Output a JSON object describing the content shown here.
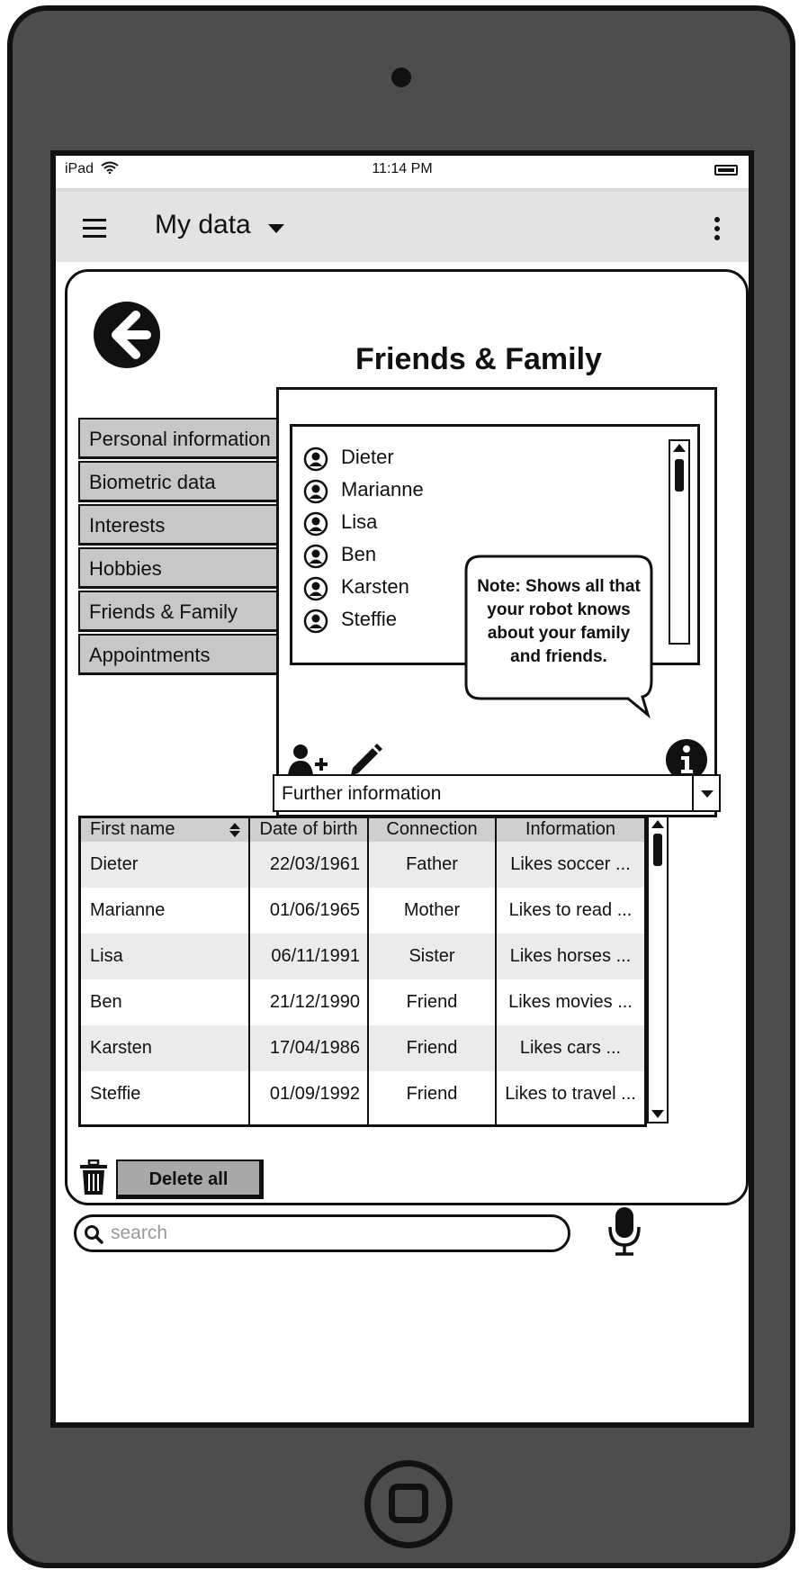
{
  "status_bar": {
    "carrier": "iPad",
    "time": "11:14 PM"
  },
  "app_bar": {
    "title": "My data"
  },
  "page": {
    "title": "Friends & Family"
  },
  "side_tabs": [
    {
      "label": "Personal information"
    },
    {
      "label": "Biometric data"
    },
    {
      "label": "Interests"
    },
    {
      "label": "Hobbies"
    },
    {
      "label": "Friends & Family"
    },
    {
      "label": "Appointments"
    }
  ],
  "people_list": [
    "Dieter",
    "Marianne",
    "Lisa",
    "Ben",
    "Karsten",
    "Steffie"
  ],
  "note": {
    "text": "Note: Shows all that your robot knows about your family and friends."
  },
  "further_info": {
    "selected": "Further information"
  },
  "table": {
    "headers": [
      "First name",
      "Date of birth",
      "Connection",
      "Information"
    ],
    "rows": [
      [
        "Dieter",
        "22/03/1961",
        "Father",
        "Likes soccer ..."
      ],
      [
        "Marianne",
        "01/06/1965",
        "Mother",
        "Likes to read ..."
      ],
      [
        "Lisa",
        "06/11/1991",
        "Sister",
        "Likes horses ..."
      ],
      [
        "Ben",
        "21/12/1990",
        "Friend",
        "Likes movies ..."
      ],
      [
        "Karsten",
        "17/04/1986",
        "Friend",
        "Likes cars ..."
      ],
      [
        "Steffie",
        "01/09/1992",
        "Friend",
        "Likes to travel ..."
      ]
    ]
  },
  "actions": {
    "delete_all": "Delete all"
  },
  "search": {
    "placeholder": "search"
  },
  "icons": {
    "wifi": "wifi-icon",
    "battery": "battery-icon",
    "menu": "hamburger-icon",
    "more": "kebab-icon",
    "back": "back-arrow-icon",
    "person": "user-icon",
    "add_user": "add-user-icon",
    "edit": "pencil-icon",
    "info": "info-icon",
    "trash": "trash-icon",
    "search": "search-icon",
    "mic": "microphone-icon"
  },
  "colors": {
    "device": "#4d4d4d",
    "tab": "#c7c7c7",
    "button": "#a8a8a8",
    "row_alt": "#ebebeb",
    "header": "#cfcfcf"
  }
}
